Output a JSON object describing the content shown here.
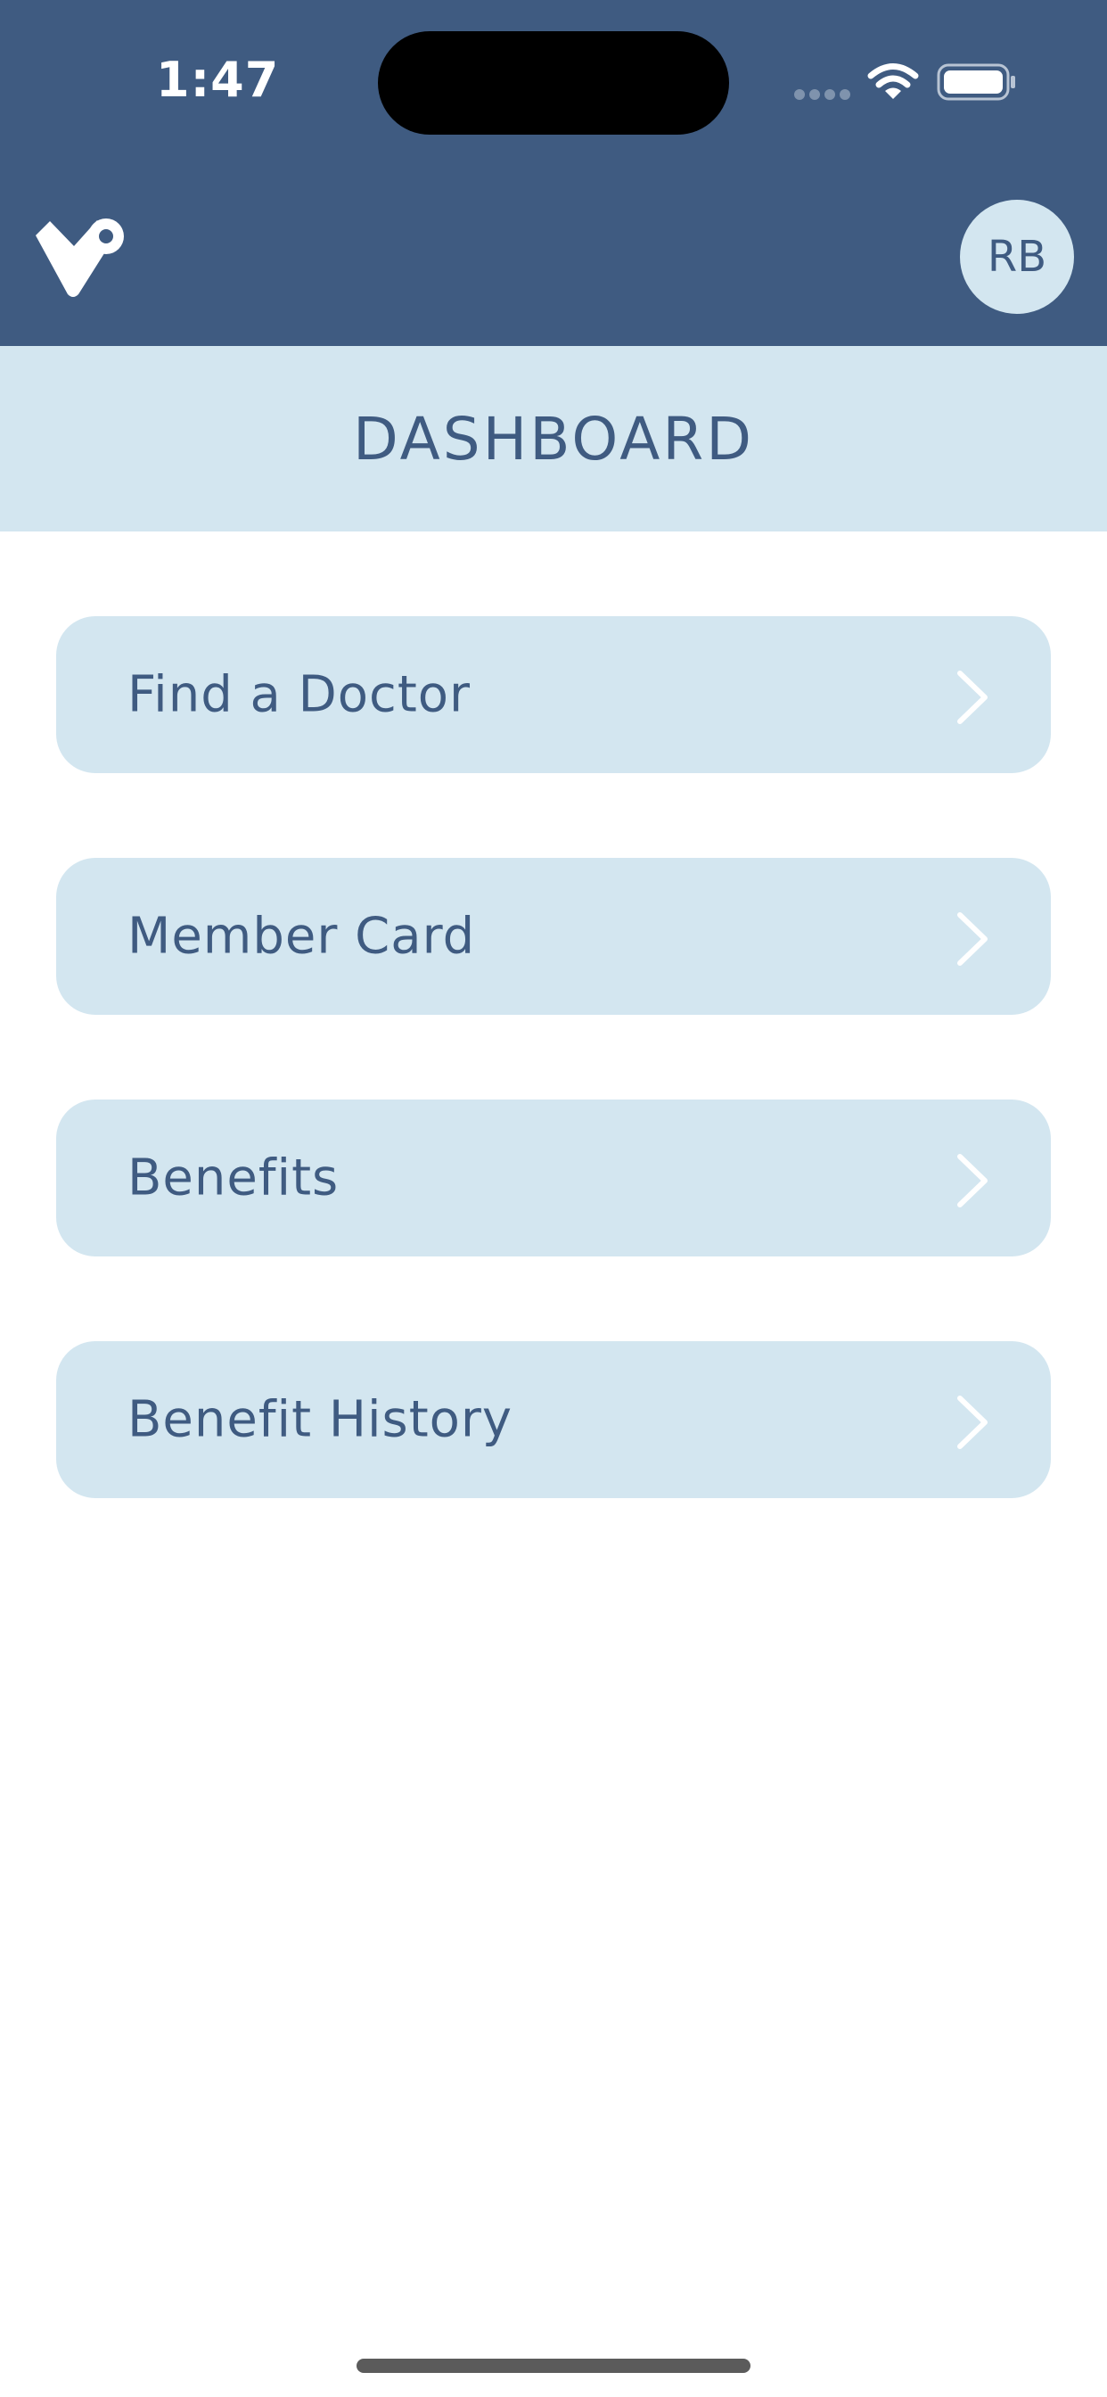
{
  "status_bar": {
    "time": "1:47",
    "signal_icon": "cellular-signal-icon",
    "wifi_icon": "wifi-icon",
    "battery_icon": "battery-icon"
  },
  "header": {
    "logo_icon": "app-logo-icon",
    "avatar_initials": "RB"
  },
  "page": {
    "title": "DASHBOARD"
  },
  "menu": {
    "items": [
      {
        "label": "Find a Doctor",
        "icon": "chevron-right-icon"
      },
      {
        "label": "Member Card",
        "icon": "chevron-right-icon"
      },
      {
        "label": "Benefits",
        "icon": "chevron-right-icon"
      },
      {
        "label": "Benefit History",
        "icon": "chevron-right-icon"
      }
    ]
  },
  "colors": {
    "header_background": "#3f5b81",
    "accent_light": "#d3e6f0",
    "text_primary": "#3f5b81",
    "chevron": "#ffffff"
  }
}
